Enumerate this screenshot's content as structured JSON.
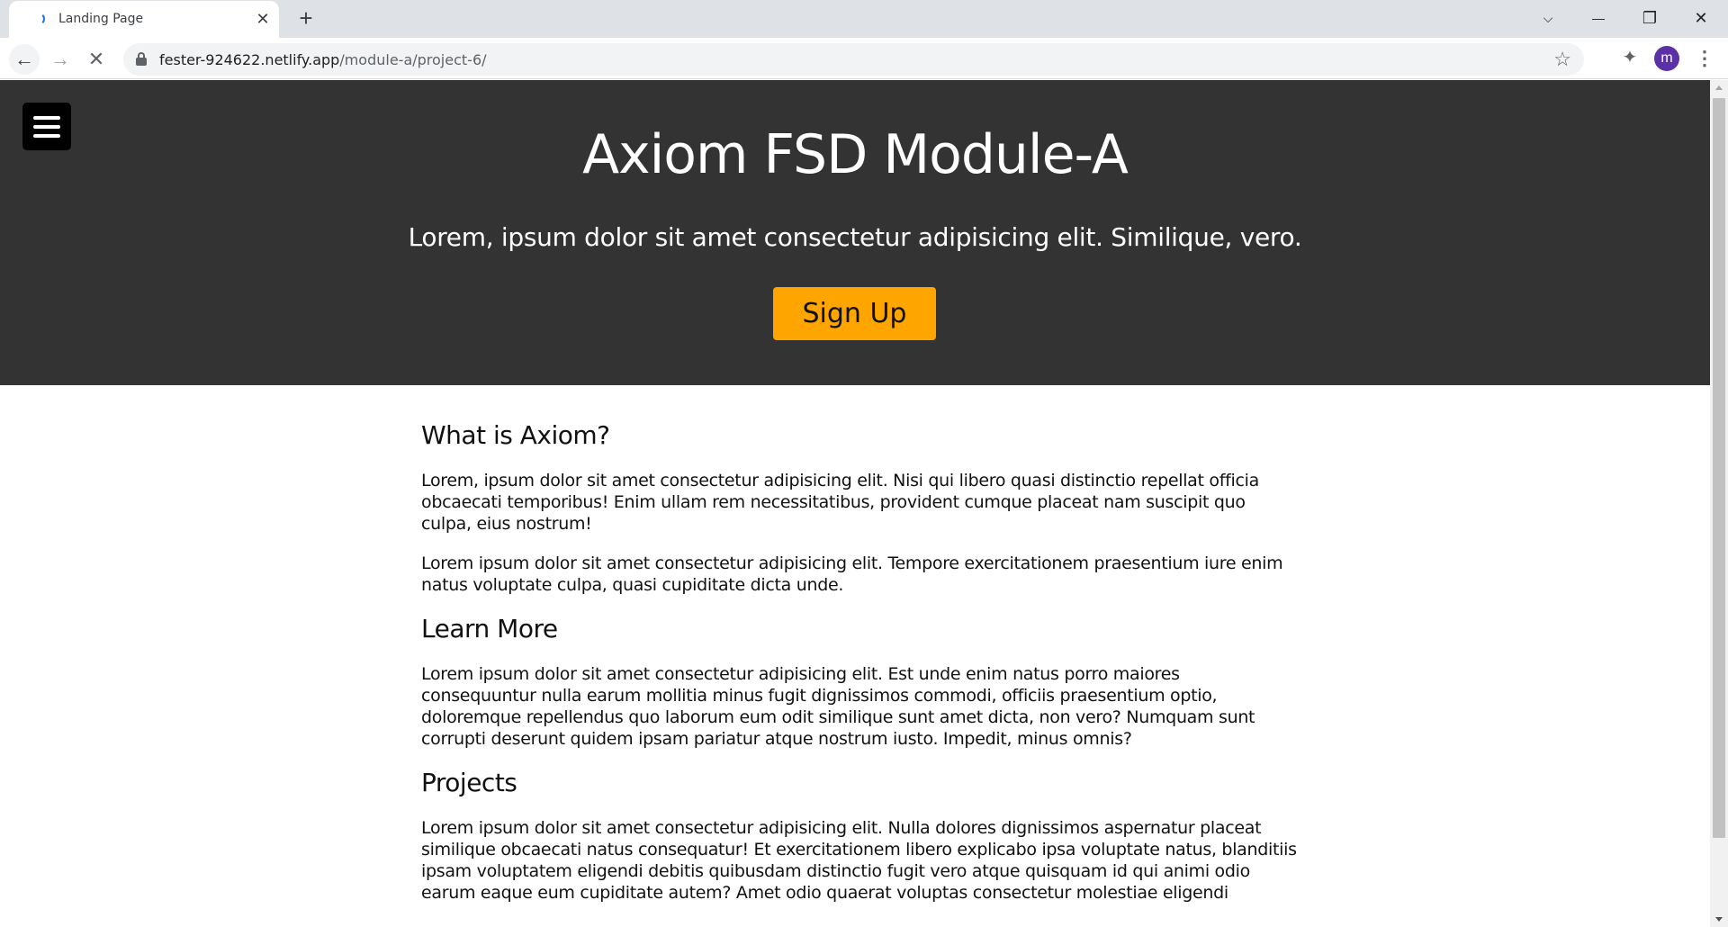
{
  "browser": {
    "tab_title": "Landing Page",
    "tab_close": "✕",
    "new_tab": "+",
    "url_host": "fester-924622.netlify.app",
    "url_path": "/module-a/project-6/",
    "avatar_letter": "m",
    "window_controls": {
      "list": "⌵",
      "minimize": "—",
      "restore": "❐",
      "close": "✕"
    },
    "icons": [
      "back-arrow-icon",
      "forward-arrow-icon",
      "stop-icon",
      "lock-icon",
      "star-icon",
      "extensions-puzzle-icon",
      "more-vert-icon"
    ]
  },
  "hero": {
    "title": "Axiom FSD Module-A",
    "subtitle": "Lorem, ipsum dolor sit amet consectetur adipisicing elit. Similique, vero.",
    "cta_label": "Sign Up",
    "cta_color": "#ffa500",
    "background": "#333333"
  },
  "sections": [
    {
      "heading": "What is Axiom?",
      "paragraphs": [
        "Lorem, ipsum dolor sit amet consectetur adipisicing elit. Nisi qui libero quasi distinctio repellat officia obcaecati temporibus! Enim ullam rem necessitatibus, provident cumque placeat nam suscipit quo culpa, eius nostrum!",
        "Lorem ipsum dolor sit amet consectetur adipisicing elit. Tempore exercitationem praesentium iure enim natus voluptate culpa, quasi cupiditate dicta unde."
      ]
    },
    {
      "heading": "Learn More",
      "paragraphs": [
        "Lorem ipsum dolor sit amet consectetur adipisicing elit. Est unde enim natus porro maiores consequuntur nulla earum mollitia minus fugit dignissimos commodi, officiis praesentium optio, doloremque repellendus quo laborum eum odit similique sunt amet dicta, non vero? Numquam sunt corrupti deserunt quidem ipsam pariatur atque nostrum iusto. Impedit, minus omnis?"
      ]
    },
    {
      "heading": "Projects",
      "paragraphs": [
        "Lorem ipsum dolor sit amet consectetur adipisicing elit. Nulla dolores dignissimos aspernatur placeat similique obcaecati natus consequatur! Et exercitationem libero explicabo ipsa voluptate natus, blanditiis ipsam voluptatem eligendi debitis quibusdam distinctio fugit vero atque quisquam id qui animi odio earum eaque eum cupiditate autem? Amet odio quaerat voluptas consectetur molestiae eligendi"
      ]
    }
  ]
}
